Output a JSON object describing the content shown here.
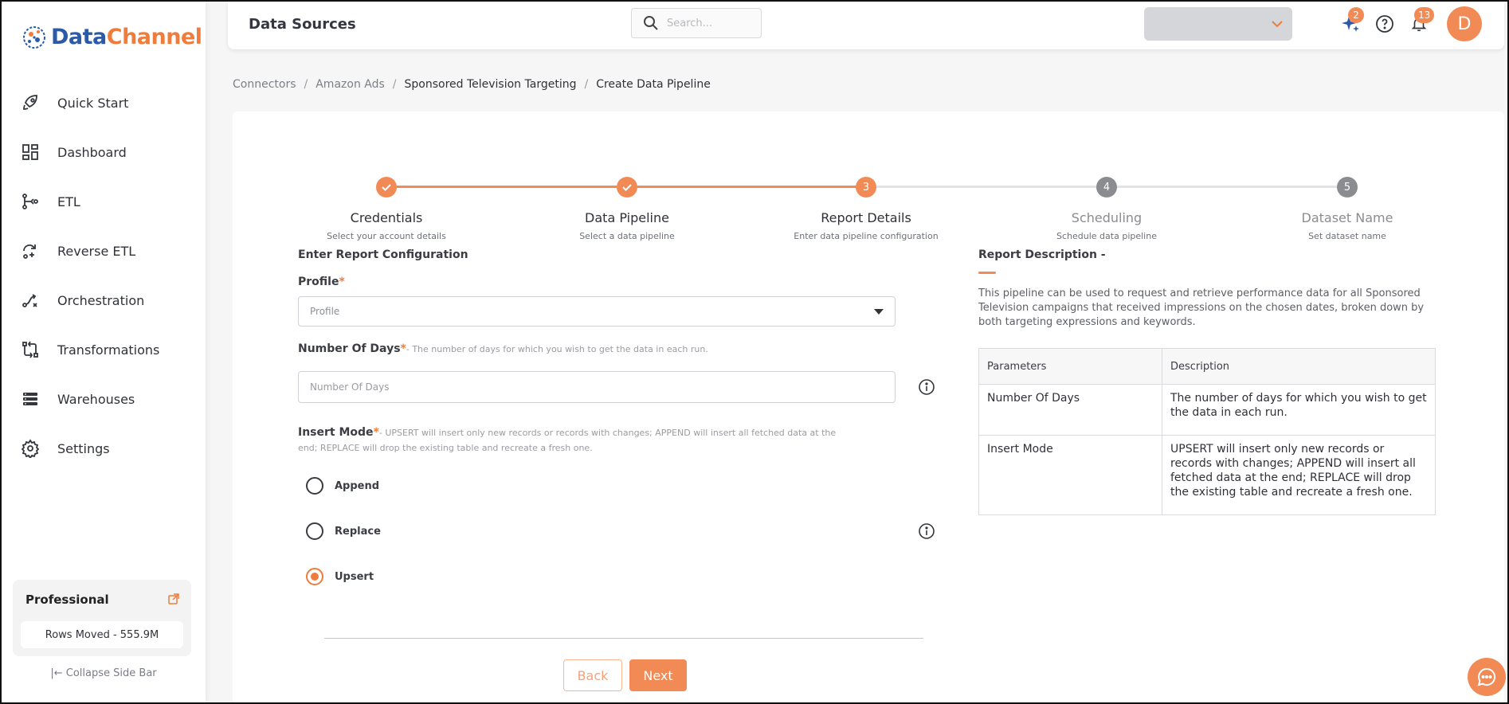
{
  "brand": {
    "name_part1": "Data",
    "name_part2": "Channel",
    "accent": "#f28a56",
    "blue": "#2a5aa8"
  },
  "sidebar": {
    "items": [
      {
        "label": "Quick Start",
        "icon": "rocket-icon"
      },
      {
        "label": "Dashboard",
        "icon": "dashboard-icon"
      },
      {
        "label": "ETL",
        "icon": "etl-icon"
      },
      {
        "label": "Reverse ETL",
        "icon": "reverse-etl-icon"
      },
      {
        "label": "Orchestration",
        "icon": "orchestration-icon"
      },
      {
        "label": "Transformations",
        "icon": "transformations-icon"
      },
      {
        "label": "Warehouses",
        "icon": "warehouses-icon"
      },
      {
        "label": "Settings",
        "icon": "gear-icon"
      }
    ],
    "plan": {
      "title": "Professional",
      "rows_moved": "Rows Moved - 555.9M"
    },
    "collapse_label": "Collapse Side Bar"
  },
  "header": {
    "title": "Data Sources",
    "search_placeholder": "Search...",
    "sparkle_badge": "2",
    "notification_badge": "13",
    "avatar_initial": "D"
  },
  "breadcrumb": [
    "Connectors",
    "Amazon Ads",
    "Sponsored Television Targeting",
    "Create Data Pipeline"
  ],
  "stepper": {
    "steps": [
      {
        "title": "Credentials",
        "subtitle": "Select your account details",
        "state": "done",
        "number": "1"
      },
      {
        "title": "Data Pipeline",
        "subtitle": "Select a data pipeline",
        "state": "done",
        "number": "2"
      },
      {
        "title": "Report Details",
        "subtitle": "Enter data pipeline configuration",
        "state": "active",
        "number": "3"
      },
      {
        "title": "Scheduling",
        "subtitle": "Schedule data pipeline",
        "state": "pending",
        "number": "4"
      },
      {
        "title": "Dataset Name",
        "subtitle": "Set dataset name",
        "state": "pending",
        "number": "5"
      }
    ]
  },
  "form": {
    "title": "Enter Report Configuration",
    "profile": {
      "label": "Profile",
      "required": "*",
      "placeholder": "Profile"
    },
    "days": {
      "label": "Number Of Days",
      "required": "*",
      "hint": "- The number of days for which you wish to get the data in each run.",
      "placeholder": "Number Of Days"
    },
    "insert_mode": {
      "label": "Insert Mode",
      "required": "*",
      "hint": "- UPSERT will insert only new records or records with changes; APPEND will insert all fetched data at the end; REPLACE will drop the existing table and recreate a fresh one.",
      "options": [
        "Append",
        "Replace",
        "Upsert"
      ],
      "selected": "Upsert"
    },
    "back_label": "Back",
    "next_label": "Next"
  },
  "description": {
    "title": "Report Description -",
    "text": "This pipeline can be used to request and retrieve performance data for all Sponsored Television campaigns that received impressions on the chosen dates, broken down by both targeting expressions and keywords.",
    "table": {
      "headers": [
        "Parameters",
        "Description"
      ],
      "rows": [
        [
          "Number Of Days",
          "The number of days for which you wish to get the data in each run."
        ],
        [
          "Insert Mode",
          "UPSERT will insert only new records or records with changes; APPEND will insert all fetched data at the end; REPLACE will drop the existing table and recreate a fresh one."
        ]
      ]
    }
  }
}
